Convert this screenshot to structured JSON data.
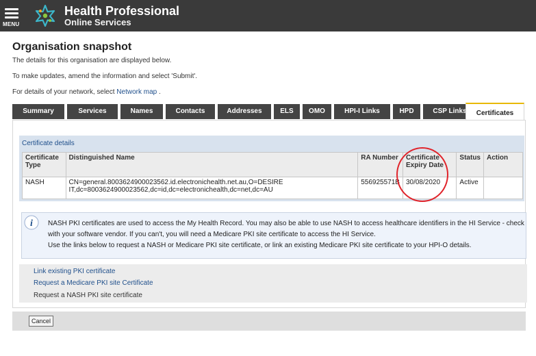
{
  "header": {
    "menu_label": "MENU",
    "brand_line1": "Health Professional",
    "brand_line2": "Online Services",
    "bar_color": "#3a3a3a",
    "logo_icon": "star-logo-icon"
  },
  "page": {
    "title": "Organisation snapshot",
    "intro1": "The details for this organisation are displayed below.",
    "intro2": "To make updates, amend the information and select 'Submit'.",
    "intro3_prefix": "For details of your network, select ",
    "intro3_link": "Network map",
    "intro3_suffix": " ."
  },
  "tabs": [
    {
      "label": "Summary"
    },
    {
      "label": "Services"
    },
    {
      "label": "Names"
    },
    {
      "label": "Contacts"
    },
    {
      "label": "Addresses"
    },
    {
      "label": "ELS"
    },
    {
      "label": "OMO"
    },
    {
      "label": "HPI-I Links"
    },
    {
      "label": "HPD"
    },
    {
      "label": "CSP Links"
    },
    {
      "label": "Certificates",
      "active": true
    }
  ],
  "certificates": {
    "section_title": "Certificate details",
    "columns": {
      "type_line1": "Certificate",
      "type_line2": "Type",
      "dn": "Distinguished Name",
      "ra": "RA Number",
      "expiry_line1": "Certificate",
      "expiry_line2": "Expiry Date",
      "status": "Status",
      "action": "Action"
    },
    "rows": [
      {
        "type": "NASH",
        "dn_line1": "CN=general.8003624900023562.id.electronichealth.net.au,O=DESIRE",
        "dn_line2": "IT,dc=8003624900023562,dc=id,dc=electronichealth,dc=net,dc=AU",
        "ra": "556925571B",
        "expiry": "30/08/2020",
        "status": "Active",
        "action": ""
      }
    ],
    "highlight_color": "#e0232a"
  },
  "info": {
    "icon": "info-icon",
    "line1": "NASH PKI certificates are used to access the My Health Record. You may also be able to use NASH to access healthcare identifiers in the HI Service - check",
    "line2": "with your software vendor. If you can't, you will need a Medicare PKI site certificate to access the HI Service.",
    "line3": "Use the links below to request a NASH or Medicare PKI site certificate, or link an existing Medicare PKI site certificate to your HPI-O details."
  },
  "links": {
    "link_existing": "Link existing PKI certificate",
    "request_medicare": "Request a Medicare PKI site Certificate",
    "request_nash": "Request a NASH PKI site certificate"
  },
  "footer": {
    "cancel_label": "Cancel"
  }
}
